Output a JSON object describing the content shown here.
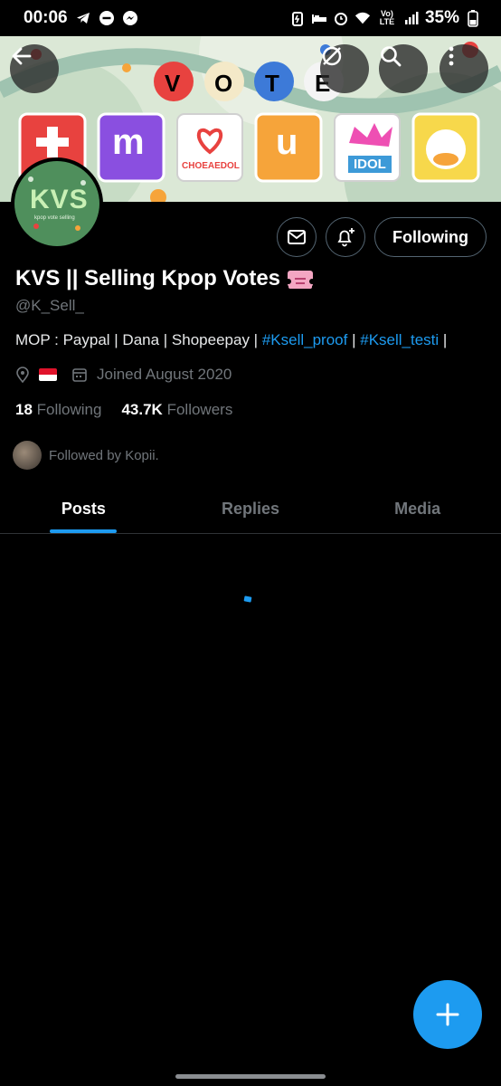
{
  "status_bar": {
    "time": "00:06",
    "battery": "35%",
    "icons": [
      "telegram-icon",
      "dnd-icon",
      "messenger-icon",
      "battery-saver-icon",
      "sleep-mode-icon",
      "alarm-icon",
      "wifi-icon",
      "volte-icon",
      "signal-icon",
      "battery-icon"
    ]
  },
  "header": {
    "back_icon": "arrow-left-icon",
    "dropdown_icon": "caret-down-icon",
    "search_icon": "search-icon",
    "more_icon": "more-vertical-icon"
  },
  "banner": {
    "vote_letters": [
      "V",
      "O",
      "T",
      "E"
    ],
    "app_tiles": [
      "CHOEAEDOL",
      "IDOL"
    ],
    "colors": {
      "bg": "#dbe8d6",
      "red": "#e8423f",
      "purple": "#8a4fe0",
      "orange": "#f6a43a",
      "yellow": "#f7d84b",
      "blue": "#3d7ad8"
    }
  },
  "avatar": {
    "text": "KVS",
    "subtext": "kpop vote selling"
  },
  "actions": {
    "message_icon": "envelope-icon",
    "notify_icon": "bell-plus-icon",
    "follow_label": "Following"
  },
  "profile": {
    "name": "KVS || Selling Kpop Votes",
    "ticket_icon": "ticket-icon",
    "handle": "@K_Sell_",
    "bio_prefix": "MOP : Paypal | Dana | Shopeepay |",
    "bio_tag1": "#Ksell_proof",
    "bio_sep": "|",
    "bio_tag2": "#Ksell_testi",
    "bio_suffix": "|",
    "location_icon": "location-pin-icon",
    "flag": "indonesia-flag",
    "calendar_icon": "calendar-icon",
    "joined": "Joined August 2020",
    "following_count": "18",
    "following_label": "Following",
    "followers_count": "43.7K",
    "followers_label": "Followers",
    "followed_by": "Followed by Kopii."
  },
  "tabs": [
    {
      "label": "Posts",
      "active": true
    },
    {
      "label": "Replies",
      "active": false
    },
    {
      "label": "Media",
      "active": false
    }
  ],
  "fab": {
    "icon": "plus-icon"
  },
  "colors": {
    "accent": "#1d9bf0",
    "background": "#000000",
    "muted": "#71767b",
    "text": "#e7e9ea"
  }
}
